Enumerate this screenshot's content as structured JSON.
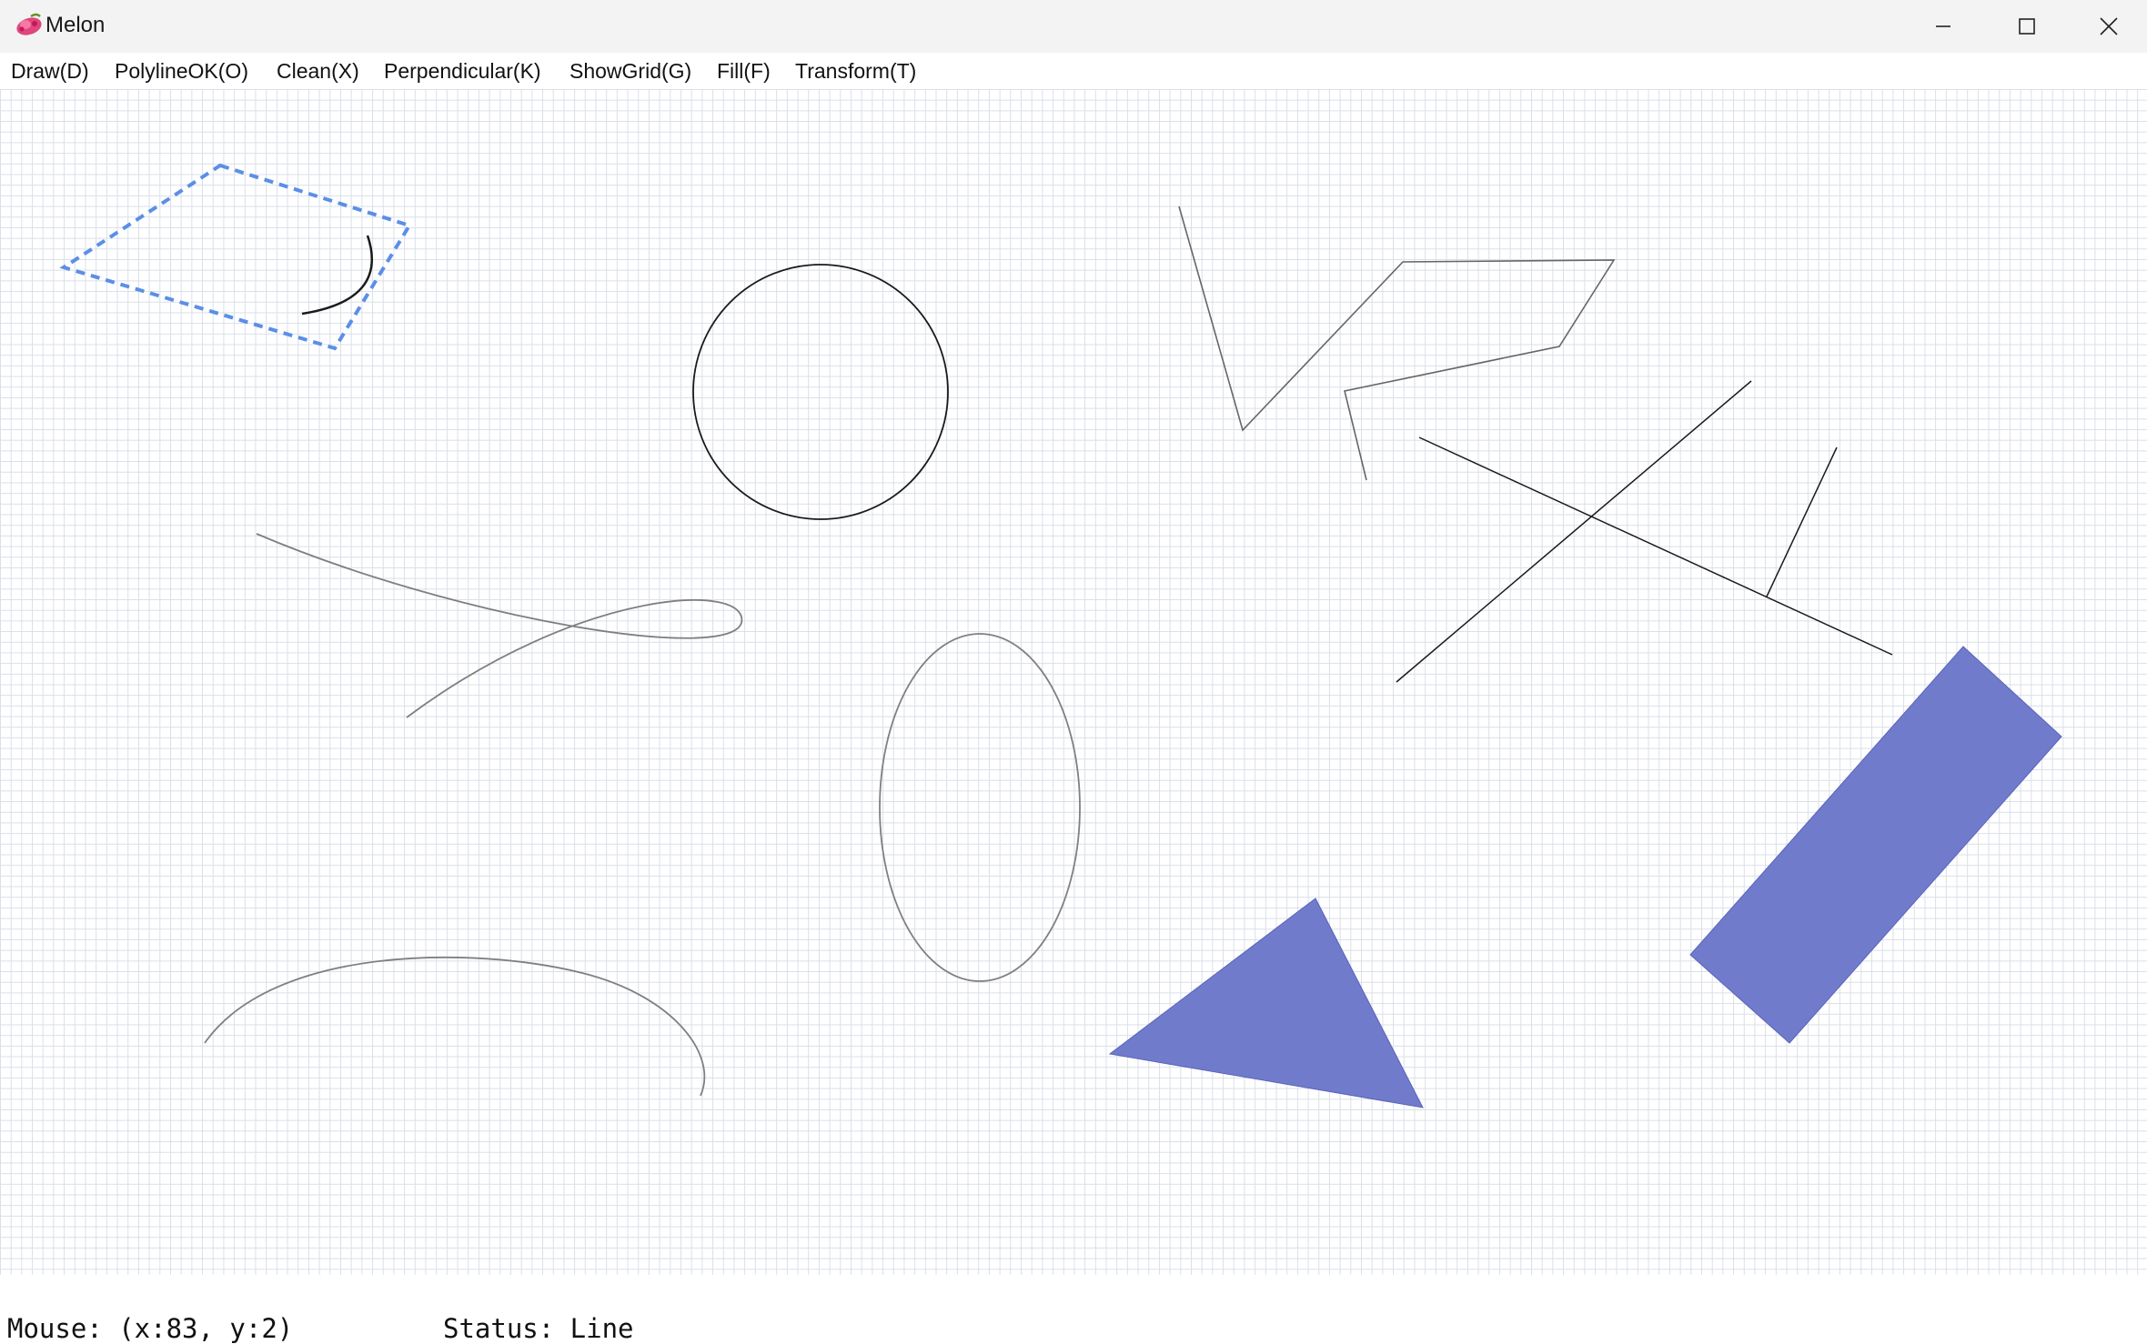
{
  "window": {
    "title": "Melon",
    "icon": "melon-app-icon",
    "controls": {
      "minimize_icon": "minimize-icon",
      "maximize_icon": "maximize-icon",
      "close_icon": "close-icon"
    }
  },
  "menu": [
    {
      "label": "Draw(D)"
    },
    {
      "label": "PolylineOK(O)"
    },
    {
      "label": "Clean(X)"
    },
    {
      "label": "Perpendicular(K)"
    },
    {
      "label": "ShowGrid(G)"
    },
    {
      "label": "Fill(F)"
    },
    {
      "label": "Transform(T)"
    }
  ],
  "canvas": {
    "grid_visible": true,
    "colors": {
      "grid": "#d9dfe9",
      "fill": "#717bcc",
      "selection_box": "#5b8fe6",
      "stroke_dark": "#1a1a1a",
      "stroke_gray": "#808080"
    },
    "shapes": [
      {
        "type": "selection-rectangle",
        "style": "dashed"
      },
      {
        "type": "arc",
        "selected": true
      },
      {
        "type": "circle"
      },
      {
        "type": "polyline"
      },
      {
        "type": "line"
      },
      {
        "type": "line"
      },
      {
        "type": "perpendicular-line"
      },
      {
        "type": "bezier-curve",
        "style": "loop"
      },
      {
        "type": "ellipse"
      },
      {
        "type": "curve",
        "style": "arch"
      },
      {
        "type": "filled-triangle"
      },
      {
        "type": "filled-rectangle",
        "rotated": true
      }
    ]
  },
  "status": {
    "mouse_text": "Mouse: (x:83, y:2)",
    "status_text": "Status: Line"
  }
}
